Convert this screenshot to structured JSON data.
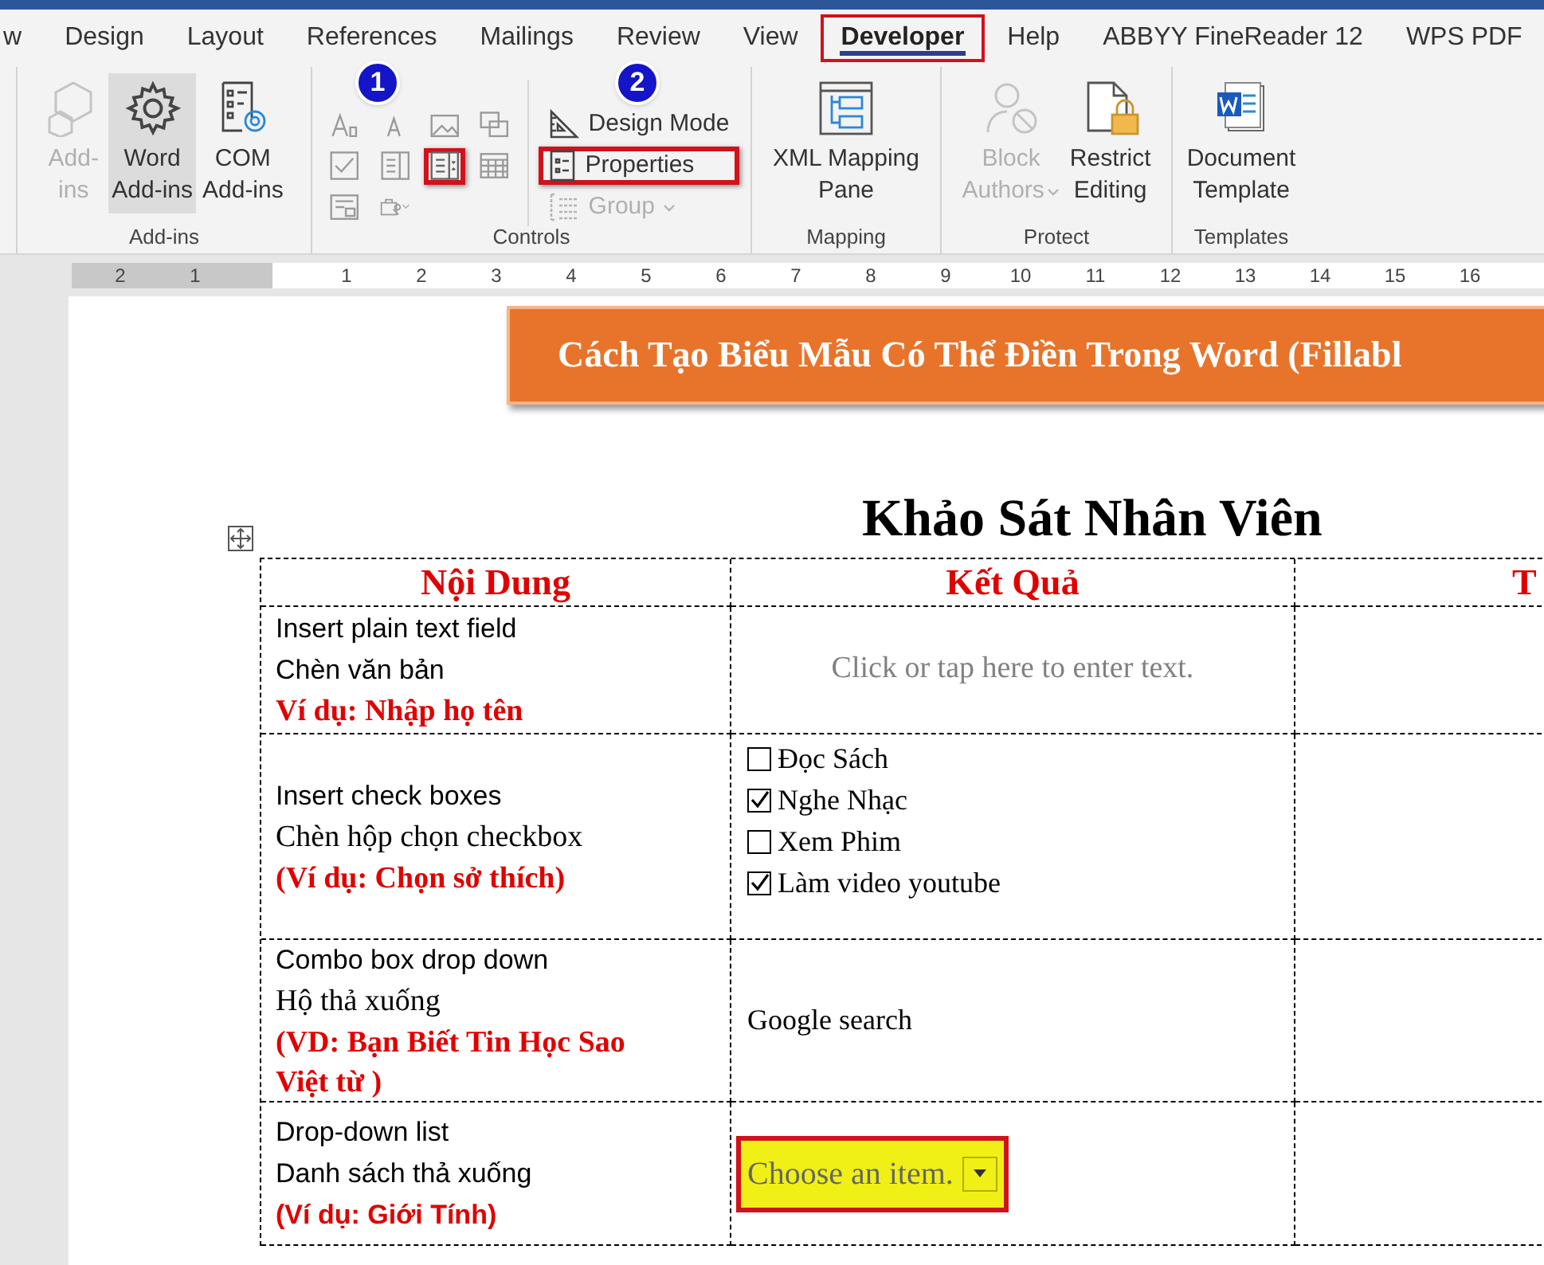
{
  "tabs": [
    {
      "label": "w",
      "selected": false,
      "highlighted": false
    },
    {
      "label": "Design",
      "selected": false,
      "highlighted": false
    },
    {
      "label": "Layout",
      "selected": false,
      "highlighted": false
    },
    {
      "label": "References",
      "selected": false,
      "highlighted": false
    },
    {
      "label": "Mailings",
      "selected": false,
      "highlighted": false
    },
    {
      "label": "Review",
      "selected": false,
      "highlighted": false
    },
    {
      "label": "View",
      "selected": false,
      "highlighted": false
    },
    {
      "label": "Developer",
      "selected": true,
      "highlighted": true
    },
    {
      "label": "Help",
      "selected": false,
      "highlighted": false
    },
    {
      "label": "ABBYY FineReader 12",
      "selected": false,
      "highlighted": false
    },
    {
      "label": "WPS PDF",
      "selected": false,
      "highlighted": false
    }
  ],
  "ribbon": {
    "groups": [
      {
        "label": "Add-ins",
        "kind": "large",
        "buttons": [
          {
            "lines": [
              "Add-",
              "ins"
            ],
            "disabled": true,
            "pressed": false,
            "caret": false
          },
          {
            "lines": [
              "Word",
              "Add-ins"
            ],
            "disabled": false,
            "pressed": true,
            "caret": false
          },
          {
            "lines": [
              "COM",
              "Add-ins"
            ],
            "disabled": false,
            "pressed": false,
            "caret": false
          }
        ]
      },
      {
        "label": "Controls",
        "kind": "controls",
        "small_buttons": [
          {
            "highlighted": false,
            "caret": false
          },
          {
            "highlighted": false,
            "caret": false
          },
          {
            "highlighted": false,
            "caret": false
          },
          {
            "highlighted": false,
            "caret": false
          },
          {
            "highlighted": false,
            "caret": false
          },
          {
            "highlighted": false,
            "caret": false
          },
          {
            "highlighted": true,
            "caret": false
          },
          {
            "highlighted": false,
            "caret": false
          },
          {
            "highlighted": false,
            "caret": false
          },
          {
            "highlighted": false,
            "caret": true
          }
        ],
        "commands": [
          {
            "label": "Design Mode",
            "disabled": false,
            "highlighted": false,
            "caret": false
          },
          {
            "label": "Properties",
            "disabled": false,
            "highlighted": true,
            "caret": false
          },
          {
            "label": "Group",
            "disabled": true,
            "highlighted": false,
            "caret": true
          }
        ]
      },
      {
        "label": "Mapping",
        "kind": "large",
        "buttons": [
          {
            "lines": [
              "XML Mapping",
              "Pane"
            ],
            "disabled": false,
            "pressed": false,
            "caret": false
          }
        ]
      },
      {
        "label": "Protect",
        "kind": "large",
        "buttons": [
          {
            "lines": [
              "Block",
              "Authors"
            ],
            "disabled": true,
            "pressed": false,
            "caret": true
          },
          {
            "lines": [
              "Restrict",
              "Editing"
            ],
            "disabled": false,
            "pressed": false,
            "caret": false
          }
        ]
      },
      {
        "label": "Templates",
        "kind": "large",
        "buttons": [
          {
            "lines": [
              "Document",
              "Template"
            ],
            "disabled": false,
            "pressed": false,
            "caret": false
          }
        ]
      }
    ]
  },
  "badges": [
    {
      "label": "1"
    },
    {
      "label": "2"
    }
  ],
  "ruler": {
    "left_numbers": [
      "2",
      "1"
    ],
    "numbers": [
      "1",
      "2",
      "3",
      "4",
      "5",
      "6",
      "7",
      "8",
      "9",
      "10",
      "11",
      "12",
      "13",
      "14",
      "15",
      "16"
    ]
  },
  "document": {
    "banner": "Cách Tạo Biểu Mẫu Có Thể Điền Trong Word (Fillabl",
    "title": "Khảo Sát Nhân Viên",
    "table": {
      "columns": [
        "Nội Dung",
        "Kết Quả",
        "T"
      ],
      "rows": [
        {
          "kind": "text_field",
          "lines": [
            {
              "text": "Insert plain text field",
              "kind": "plain"
            },
            {
              "text": "Chèn văn bản",
              "kind": "plain"
            },
            {
              "text": "Ví dụ: Nhập họ tên",
              "kind": "example"
            }
          ],
          "result": {
            "placeholder": "Click or tap here to enter text."
          }
        },
        {
          "kind": "checkboxes",
          "lines": [
            {
              "text": "Insert check boxes",
              "kind": "plain"
            },
            {
              "text": "Chèn hộp chọn checkbox",
              "kind": "serif"
            },
            {
              "text": "(Ví dụ: Chọn sở thích)",
              "kind": "example"
            }
          ],
          "result": {
            "options": [
              {
                "label": "Đọc Sách",
                "checked": false
              },
              {
                "label": "Nghe Nhạc",
                "checked": true
              },
              {
                "label": "Xem Phim",
                "checked": false
              },
              {
                "label": "Làm video youtube",
                "checked": true
              }
            ]
          }
        },
        {
          "kind": "combo",
          "lines": [
            {
              "text": "Combo box drop down",
              "kind": "plain"
            },
            {
              "text": "Hộ thả xuống",
              "kind": "serif"
            },
            {
              "text": "(VD: Bạn Biết Tin Học Sao Việt từ )",
              "kind": "example"
            }
          ],
          "result": {
            "value": "Google search"
          }
        },
        {
          "kind": "dropdown",
          "lines": [
            {
              "text": "Drop-down list",
              "kind": "plain"
            },
            {
              "text": "Danh sách thả xuống",
              "kind": "plain"
            },
            {
              "text": "(Ví dụ: Giới Tính)",
              "kind": "note"
            }
          ],
          "result": {
            "placeholder": "Choose an item.",
            "highlighted": true
          }
        }
      ]
    }
  }
}
